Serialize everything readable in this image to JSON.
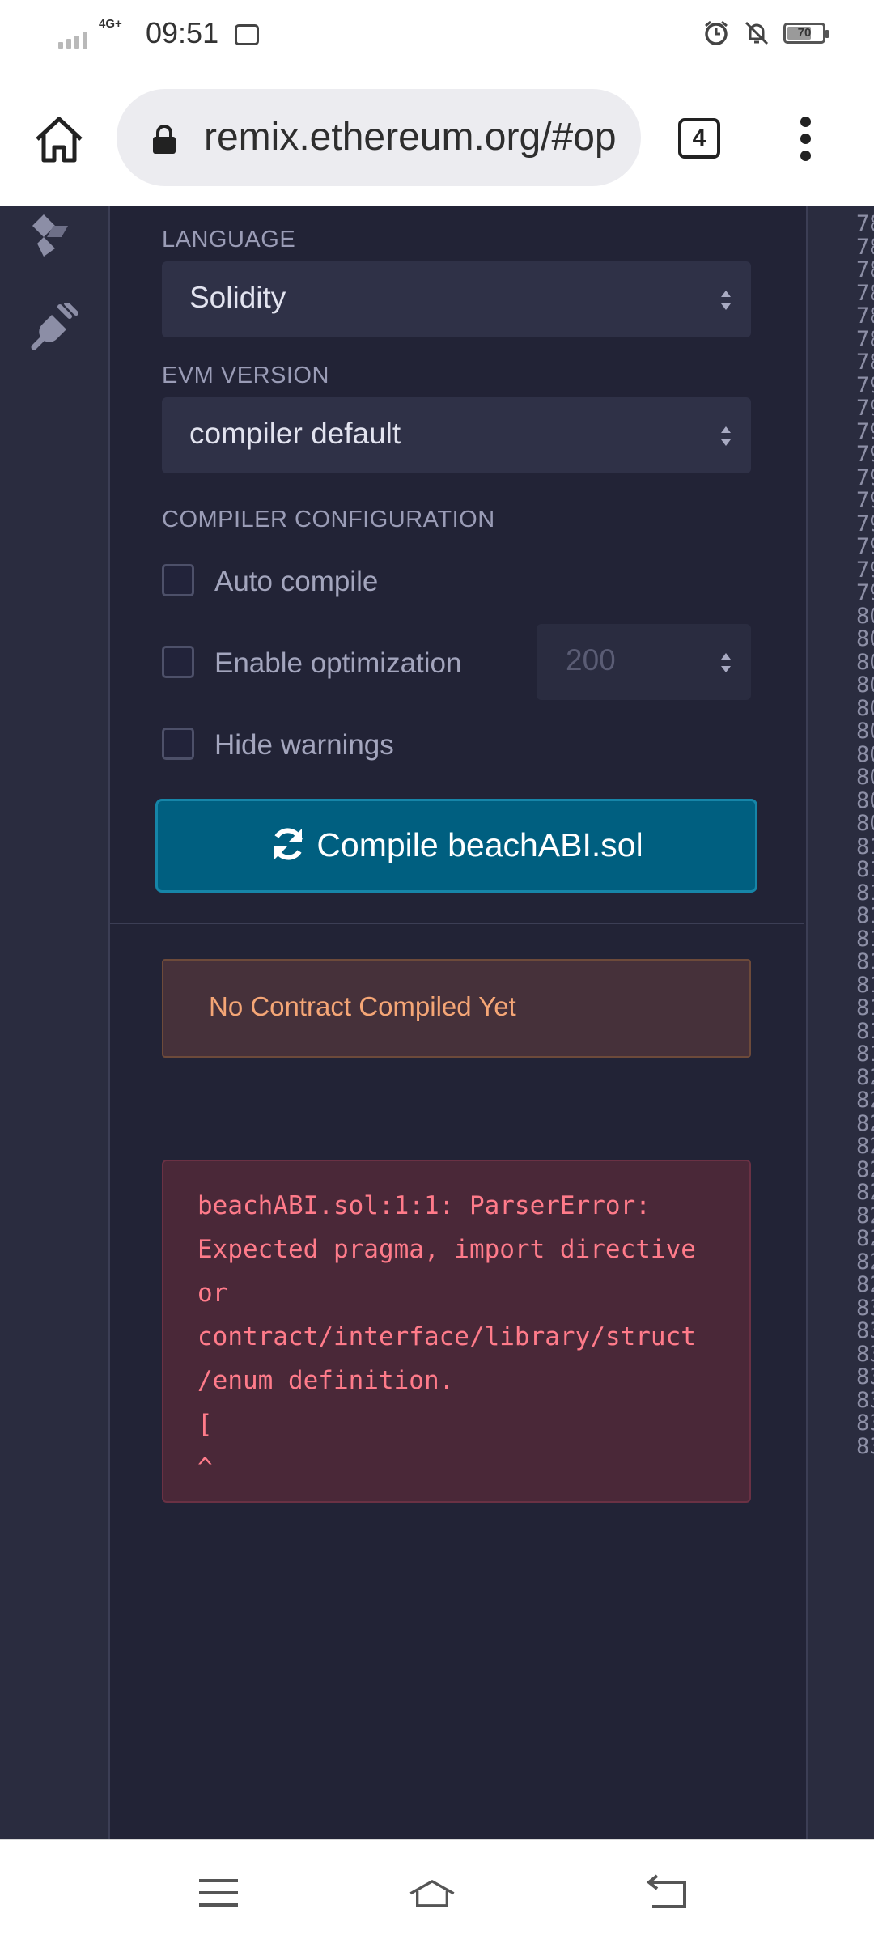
{
  "status_bar": {
    "network": "4G+",
    "time": "09:51",
    "battery": "70"
  },
  "browser": {
    "url": "remix.ethereum.org/#op",
    "tab_count": "4"
  },
  "compiler": {
    "language_label": "LANGUAGE",
    "language_value": "Solidity",
    "evm_label": "EVM VERSION",
    "evm_value": "compiler default",
    "config_label": "COMPILER CONFIGURATION",
    "auto_compile_label": "Auto compile",
    "optimization_label": "Enable optimization",
    "optimization_runs": "200",
    "hide_warnings_label": "Hide warnings",
    "compile_button_label": "Compile beachABI.sol"
  },
  "messages": {
    "no_contract": "No Contract Compiled Yet",
    "error_text": "beachABI.sol:1:1: ParserError:\nExpected pragma, import directive\nor\ncontract/interface/library/struct\n/enum definition.\n[\n^"
  },
  "editor": {
    "line_numbers": [
      "78",
      "78",
      "78",
      "78",
      "78",
      "78",
      "78",
      "79",
      "79",
      "79",
      "79",
      "79",
      "79",
      "79",
      "79",
      "79",
      "79",
      "80",
      "80",
      "80",
      "80",
      "80",
      "80",
      "80",
      "80",
      "80",
      "80",
      "81",
      "81",
      "81",
      "81",
      "81",
      "81",
      "81",
      "81",
      "81",
      "81",
      "82",
      "82",
      "82",
      "82",
      "82",
      "82",
      "82",
      "82",
      "82",
      "82",
      "83",
      "83",
      "83",
      "83",
      "83",
      "83",
      "83"
    ]
  },
  "icons": {
    "sidebar": [
      "solidity-compiler-icon",
      "plugin-manager-icon"
    ],
    "nav": [
      "recents-icon",
      "home-icon",
      "back-icon"
    ]
  }
}
